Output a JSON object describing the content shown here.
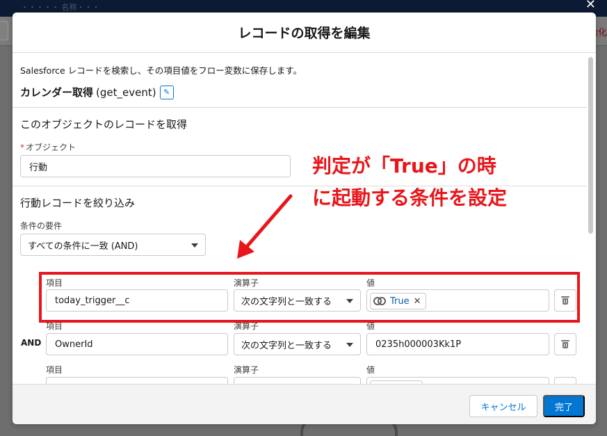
{
  "background": {
    "top_title": "・・・・・ 名称・・・",
    "right_text": "動化"
  },
  "modal": {
    "title": "レコードの取得を編集",
    "description": "Salesforce レコードを検索し、その項目値をフロー変数に保存します。",
    "element_label": "カレンダー取得",
    "element_api": "(get_event)",
    "object_section": {
      "title": "このオブジェクトのレコードを取得",
      "required_mark": "*",
      "object_label": "オブジェクト",
      "object_value": "行動"
    },
    "filter_section": {
      "title": "行動レコードを絞り込み",
      "requirement_label": "条件の要件",
      "requirement_value": "すべての条件に一致 (AND)",
      "conditions": [
        {
          "connector": "",
          "field_label": "項目",
          "field_value": "today_trigger__c",
          "operator_label": "演算子",
          "operator_value": "次の文字列と一致する",
          "value_label": "値",
          "value_pill": "True"
        },
        {
          "connector": "AND",
          "field_label": "項目",
          "field_value": "OwnerId",
          "operator_label": "演算子",
          "operator_value": "次の文字列と一致する",
          "value_label": "値",
          "value_text": "0235h000003Kk1P"
        },
        {
          "connector": "",
          "field_label": "項目",
          "operator_label": "演算子",
          "value_label": "値"
        }
      ]
    },
    "footer": {
      "cancel_label": "キャンセル",
      "done_label": "完了"
    }
  },
  "annotation": {
    "line1": "判定が「True」の時",
    "line2": "に起動する条件を設定",
    "color": "#e8161b"
  },
  "colors": {
    "brand_blue": "#0176d3",
    "annotation_red": "#e8161b"
  }
}
